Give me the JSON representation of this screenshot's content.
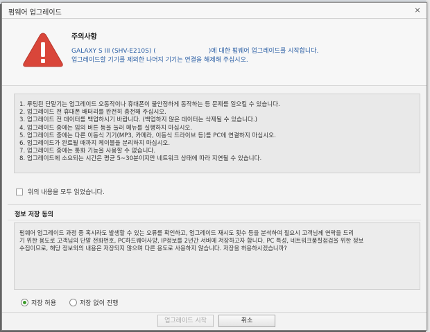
{
  "dialog": {
    "title": "펌웨어 업그레이드",
    "close_glyph": "×"
  },
  "header": {
    "caution_title": "주의사항",
    "notice_line1_device": "GALAXY S III (SHV-E210S) (",
    "notice_line1_rest": ")에 대한 펌웨어 업그레이드를 시작합니다.",
    "notice_line2": "업그레이드할 기기를 제외한 나머지 기기는 연결을 해제해 주십시오.",
    "warning_icon": "warning-triangle-icon",
    "warning_color": "#d9463a"
  },
  "notes": [
    "1. 루팅된 단말기는 업그레이드 오동작이나 휴대폰이 불안정하게 동작하는 등 문제를 일으킬 수 있습니다.",
    "2. 업그레이드 전 휴대폰 배터리를 완전히 충전해 주십시오.",
    "3. 업그레이드 전 데이터를 백업하시기 바랍니다. (백업하지 않은 데이터는 삭제될 수 있습니다.)",
    "4. 업그레이드 중에는 임의 버튼 등을 눌러 메뉴를 실행하지 마십시오.",
    "5. 업그레이드 중에는 다른 이동식 기기(MP3, 카메라, 이동식 드라이브 등)를 PC에 연결하지 마십시오.",
    "6. 업그레이드가 완료될 때까지 케이블을 분리하지 마십시오.",
    "7. 업그레이드 중에는 통화 기능을 사용할 수 없습니다.",
    "8. 업그레이드에 소요되는 시간은 평균 5~30분이지만 네트워크 상태에 따라 지연될 수 있습니다."
  ],
  "checkbox": {
    "label": "위의 내용을 모두 읽었습니다.",
    "checked": false
  },
  "consent": {
    "title": "정보 저장 동의",
    "lines": [
      "펌웨어 업그레이드 과정 중 혹시라도 발생할 수 있는 오류를 확인하고, 업그레이드 재시도 횟수 등을 분석하여 필요시 고객님께 연락을 드리",
      "기 위한 용도로 고객님의 단말 전화번호, PC하드웨어사양, IP정보를 2년간 서버에 저장하고자 합니다. PC 특성, 네트워크품질점검을 위한 정보",
      "수집이므로, 해당 정보외의 내용은 저장되지 않으며 다른 용도로 사용하지 않습니다. 저장을 허용하시겠습니까?"
    ]
  },
  "radios": {
    "allow_label": "저장 허용",
    "skip_label": "저장 없이 진행",
    "selected": "allow",
    "selected_color": "#3c9a2a"
  },
  "buttons": {
    "upgrade_label": "업그레이드 시작",
    "cancel_label": "취소"
  }
}
